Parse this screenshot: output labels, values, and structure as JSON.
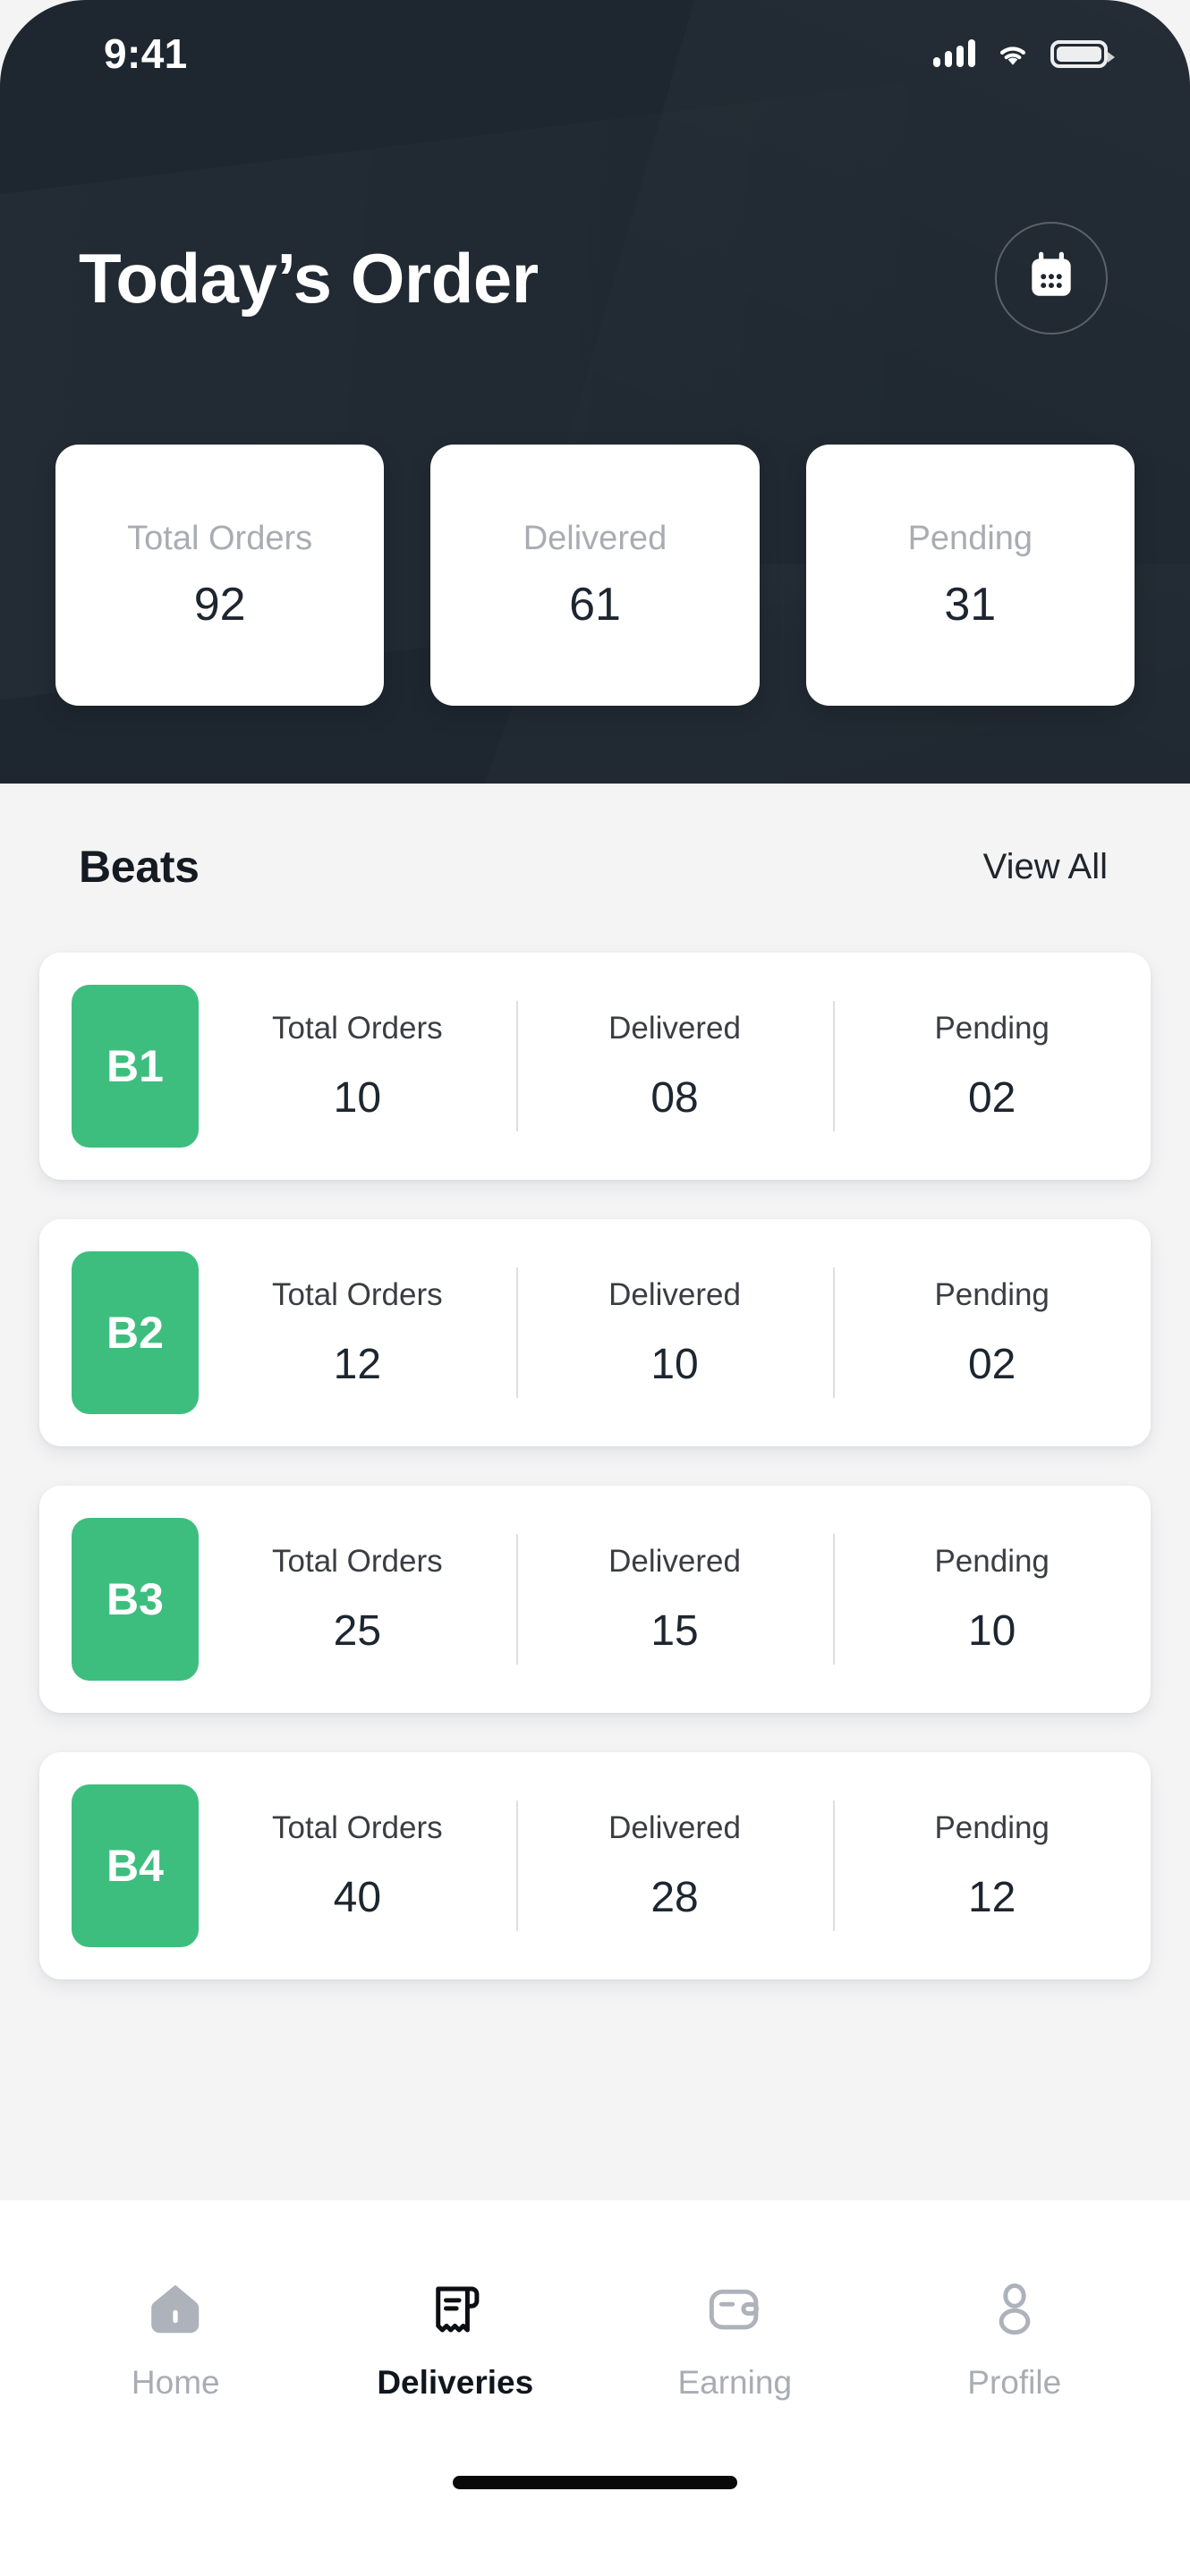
{
  "status_bar": {
    "time": "9:41",
    "icons": [
      "signal-icon",
      "wifi-icon",
      "battery-icon"
    ]
  },
  "header": {
    "title": "Today’s Order",
    "calendar_button_icon": "calendar-icon",
    "background_color": "#1e2730",
    "summary": [
      {
        "label": "Total Orders",
        "value": "92"
      },
      {
        "label": "Delivered",
        "value": "61"
      },
      {
        "label": "Pending",
        "value": "31"
      }
    ]
  },
  "beats_section": {
    "title": "Beats",
    "view_all_label": "View All",
    "badge_color": "#3dbe7e",
    "columns": [
      "Total Orders",
      "Delivered",
      "Pending"
    ],
    "rows": [
      {
        "badge": "B1",
        "total_orders": "10",
        "delivered": "08",
        "pending": "02"
      },
      {
        "badge": "B2",
        "total_orders": "12",
        "delivered": "10",
        "pending": "02"
      },
      {
        "badge": "B3",
        "total_orders": "25",
        "delivered": "15",
        "pending": "10"
      },
      {
        "badge": "B4",
        "total_orders": "40",
        "delivered": "28",
        "pending": "12"
      }
    ]
  },
  "bottom_nav": {
    "items": [
      {
        "label": "Home",
        "icon": "home-icon",
        "active": false
      },
      {
        "label": "Deliveries",
        "icon": "receipt-icon",
        "active": true
      },
      {
        "label": "Earning",
        "icon": "wallet-icon",
        "active": false
      },
      {
        "label": "Profile",
        "icon": "person-icon",
        "active": false
      }
    ],
    "active_color": "#10161d",
    "inactive_color": "#a9acb3"
  }
}
